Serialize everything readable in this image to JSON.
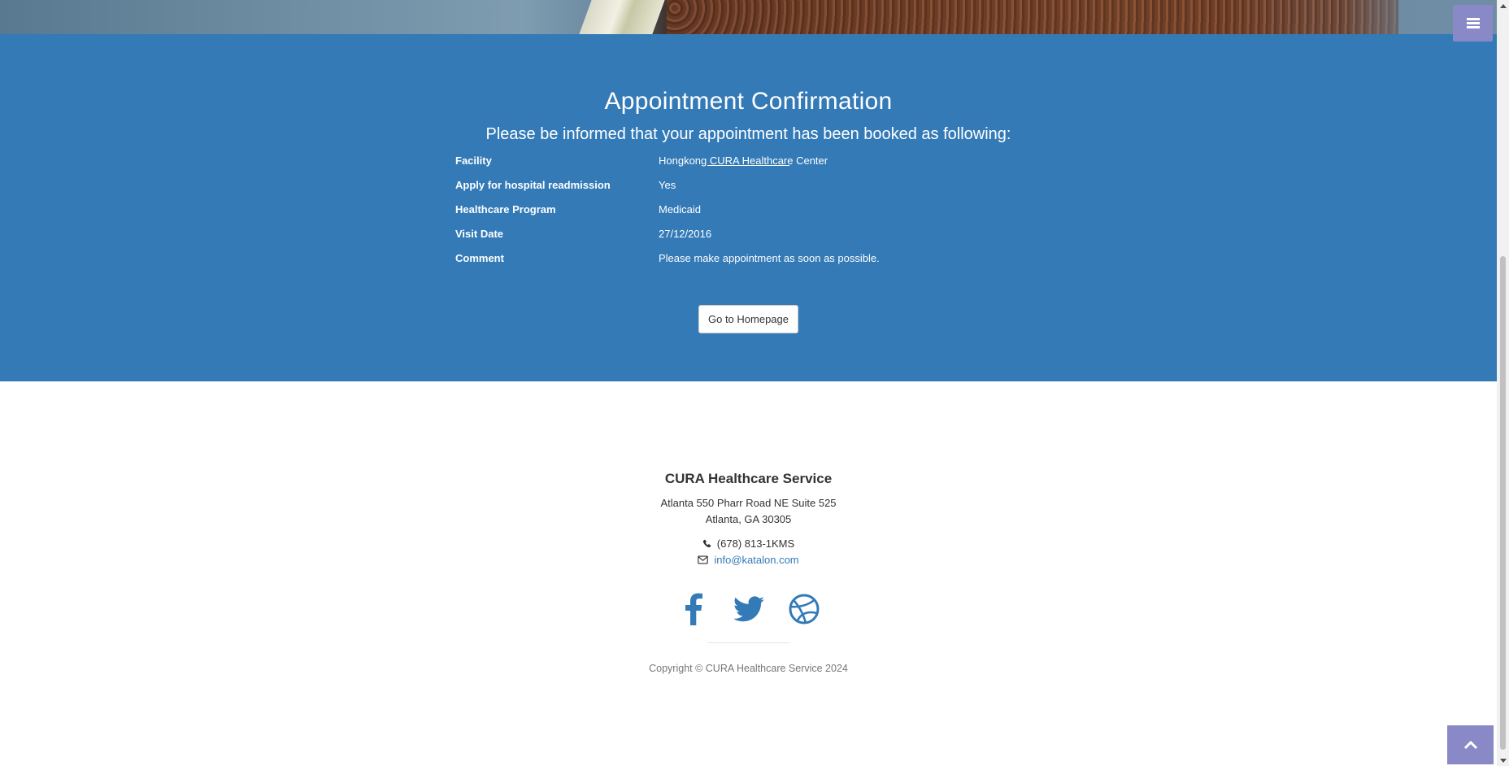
{
  "menu": {
    "icon": "hamburger-menu-icon"
  },
  "confirmation": {
    "title": "Appointment Confirmation",
    "lead": "Please be informed that your appointment has been booked as following:",
    "details": [
      {
        "label": "Facility",
        "value": "Hongkong CURA Healthcare Center"
      },
      {
        "label": "Apply for hospital readmission",
        "value": "Yes"
      },
      {
        "label": "Healthcare Program",
        "value": "Medicaid"
      },
      {
        "label": "Visit Date",
        "value": "27/12/2016"
      },
      {
        "label": "Comment",
        "value": "Please make appointment as soon as possible."
      }
    ],
    "home_button": "Go to Homepage"
  },
  "footer": {
    "brand": "CURA Healthcare Service",
    "address_line1": "Atlanta 550 Pharr Road NE Suite 525",
    "address_line2": "Atlanta, GA 30305",
    "phone": "(678) 813-1KMS",
    "email": "info@katalon.com",
    "socials": [
      "facebook-icon",
      "twitter-icon",
      "dribbble-icon"
    ],
    "copyright": "Copyright © CURA Healthcare Service 2024"
  },
  "colors": {
    "primary": "#337ab7",
    "accent": "#8a89c7",
    "text": "#333333",
    "muted": "#777777"
  }
}
